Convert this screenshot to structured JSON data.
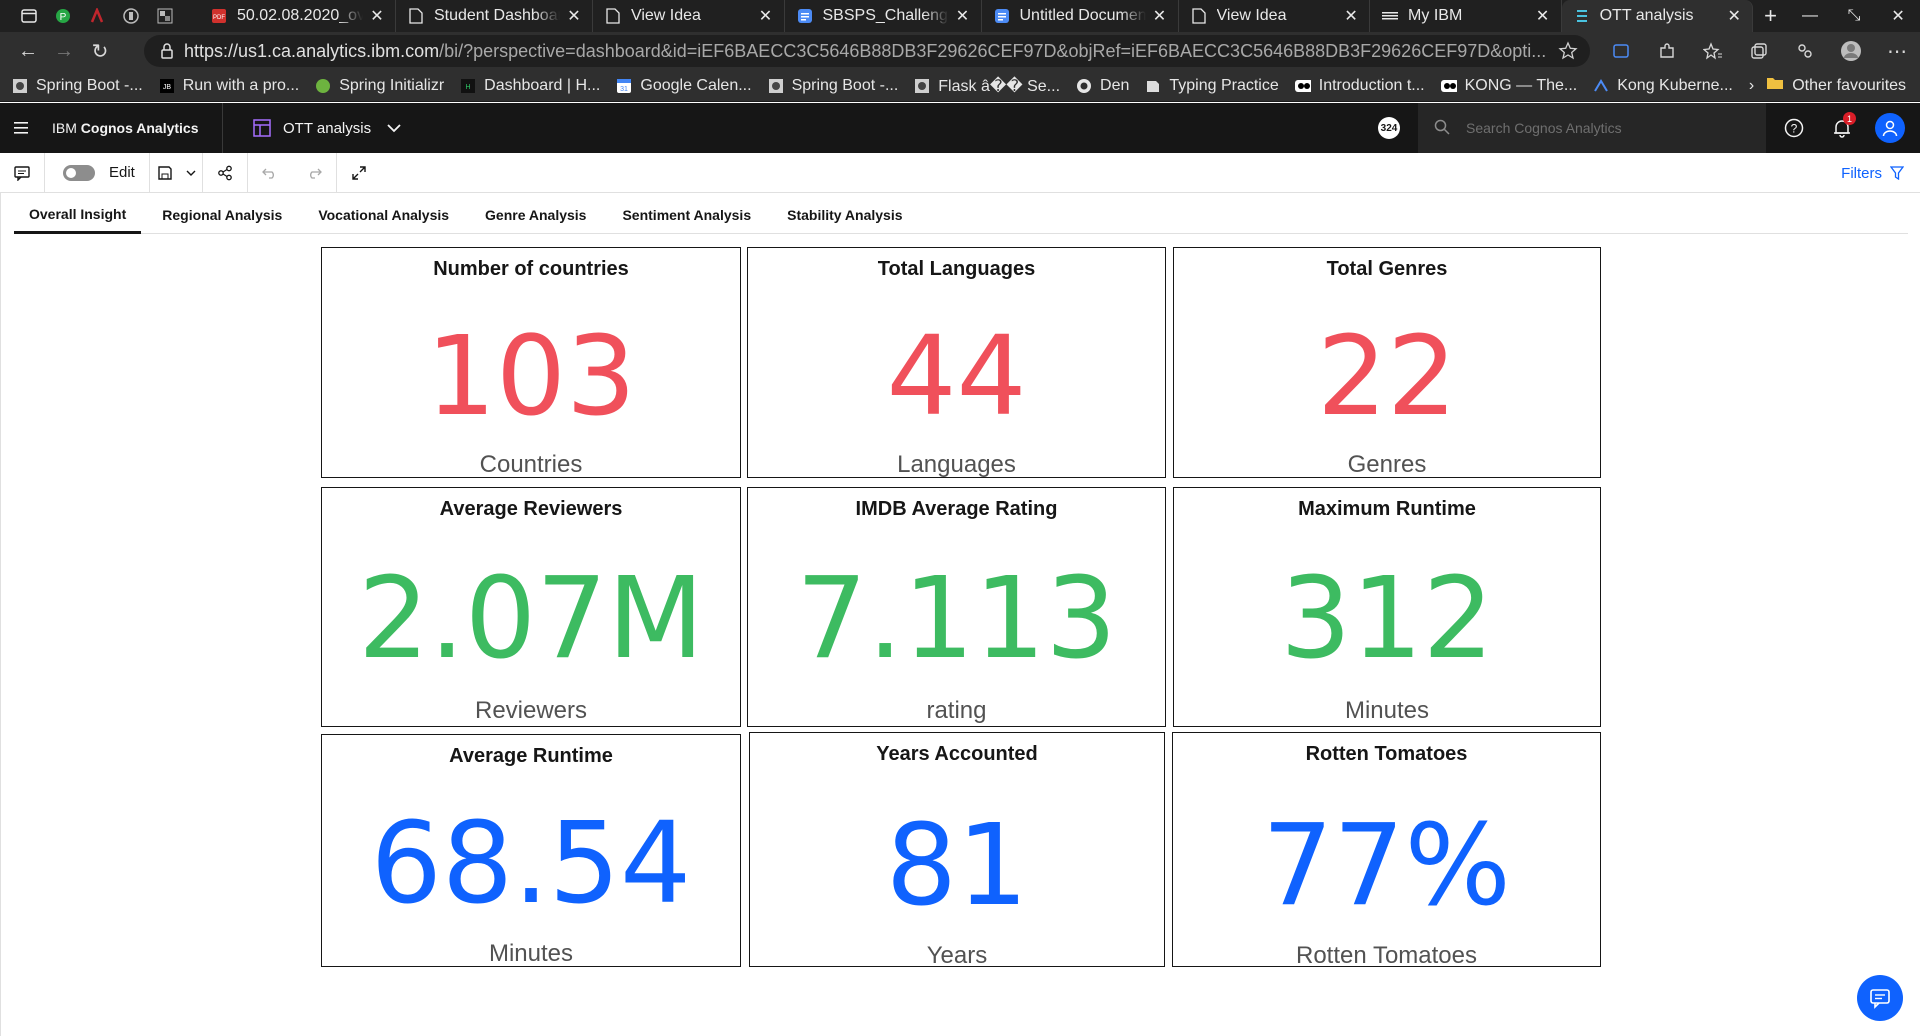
{
  "browser": {
    "tabs": [
      {
        "title": "50.02.08.2020_ov",
        "favicon": "pdf-icon",
        "active": false
      },
      {
        "title": "Student Dashboar",
        "favicon": "page-icon",
        "active": false
      },
      {
        "title": "View Idea",
        "favicon": "page-icon",
        "active": false
      },
      {
        "title": "SBSPS_Challenge",
        "favicon": "docs-icon",
        "active": false
      },
      {
        "title": "Untitled Documen",
        "favicon": "docs-icon",
        "active": false
      },
      {
        "title": "View Idea",
        "favicon": "page-icon",
        "active": false
      },
      {
        "title": "My IBM",
        "favicon": "ibm-icon",
        "active": false
      },
      {
        "title": "OTT analysis",
        "favicon": "cognos-icon",
        "active": true
      }
    ],
    "url_host": "https://us1.ca.analytics.ibm.com",
    "url_rest": "/bi/?perspective=dashboard&id=iEF6BAECC3C5646B88DB3F29626CEF97D&objRef=iEF6BAECC3C5646B88DB3F29626CEF97D&opti...",
    "bookmarks": [
      {
        "label": "Spring Boot -...",
        "icon": "spring-icon"
      },
      {
        "label": "Run with a pro...",
        "icon": "jb-icon"
      },
      {
        "label": "Spring Initializr",
        "icon": "leaf-icon"
      },
      {
        "label": "Dashboard | H...",
        "icon": "hackerrank-icon"
      },
      {
        "label": "Google Calen...",
        "icon": "calendar-icon"
      },
      {
        "label": "Spring Boot -...",
        "icon": "spring-icon"
      },
      {
        "label": "Flask â�� Se...",
        "icon": "flask-icon"
      },
      {
        "label": "Den",
        "icon": "github-icon"
      },
      {
        "label": "Typing Practice",
        "icon": "keyboard-icon"
      },
      {
        "label": "Introduction t...",
        "icon": "video-icon"
      },
      {
        "label": "KONG — The...",
        "icon": "video-icon"
      },
      {
        "label": "Kong Kuberne...",
        "icon": "kong-icon"
      }
    ],
    "other_favourites": "Other favourites"
  },
  "app": {
    "brand_prefix": "IBM ",
    "brand_name": "Cognos Analytics",
    "dashboard_name": "OTT analysis",
    "notifications_badge": "324",
    "bell_count": "1",
    "search_placeholder": "Search Cognos Analytics"
  },
  "toolbar": {
    "edit_label": "Edit",
    "filters_label": "Filters"
  },
  "dashboard_tabs": [
    {
      "label": "Overall Insight",
      "active": true
    },
    {
      "label": "Regional Analysis",
      "active": false
    },
    {
      "label": "Vocational Analysis",
      "active": false
    },
    {
      "label": "Genre Analysis",
      "active": false
    },
    {
      "label": "Sentiment Analysis",
      "active": false
    },
    {
      "label": "Stability Analysis",
      "active": false
    }
  ],
  "colors": {
    "red": "#f0505b",
    "green": "#3dbb61",
    "blue": "#0f62fe"
  },
  "kpis": [
    {
      "title": "Number of countries",
      "value": "103",
      "unit": "Countries",
      "color": "red"
    },
    {
      "title": "Total Languages",
      "value": "44",
      "unit": "Languages",
      "color": "red"
    },
    {
      "title": "Total Genres",
      "value": "22",
      "unit": "Genres",
      "color": "red"
    },
    {
      "title": "Average Reviewers",
      "value": "2.07M",
      "unit": "Reviewers",
      "color": "green"
    },
    {
      "title": "IMDB Average Rating",
      "value": "7.113",
      "unit": "rating",
      "color": "green"
    },
    {
      "title": "Maximum Runtime",
      "value": "312",
      "unit": "Minutes",
      "color": "green"
    },
    {
      "title": "Average Runtime",
      "value": "68.54",
      "unit": "Minutes",
      "color": "blue"
    },
    {
      "title": "Years Accounted",
      "value": "81",
      "unit": "Years",
      "color": "blue"
    },
    {
      "title": "Rotten Tomatoes",
      "value": "77%",
      "unit": "Rotten Tomatoes",
      "color": "blue"
    }
  ]
}
